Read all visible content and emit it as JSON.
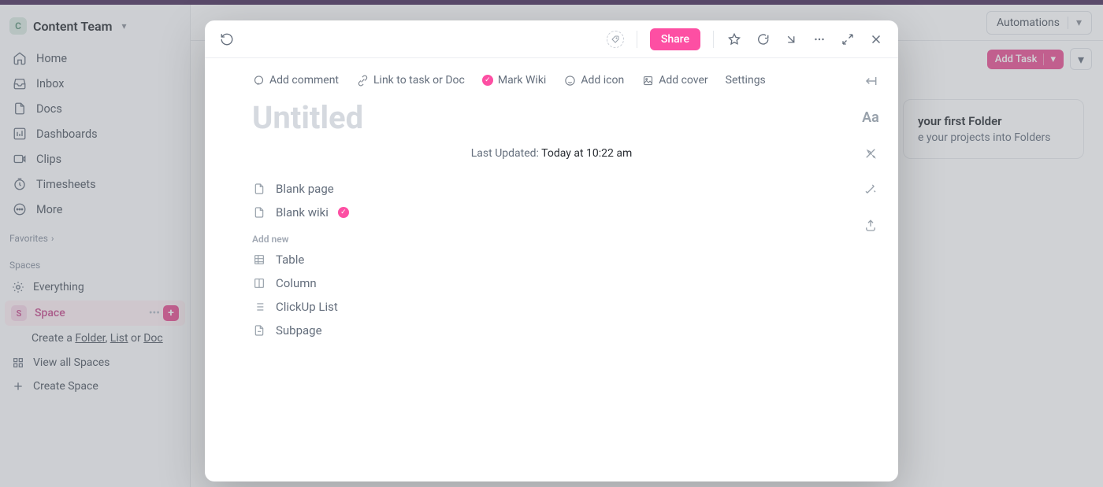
{
  "workspace": {
    "badge": "C",
    "name": "Content Team"
  },
  "sidebar": {
    "nav": [
      {
        "label": "Home",
        "icon": "home-icon"
      },
      {
        "label": "Inbox",
        "icon": "inbox-icon"
      },
      {
        "label": "Docs",
        "icon": "docs-icon"
      },
      {
        "label": "Dashboards",
        "icon": "dashboards-icon"
      },
      {
        "label": "Clips",
        "icon": "clips-icon"
      },
      {
        "label": "Timesheets",
        "icon": "timesheets-icon"
      },
      {
        "label": "More",
        "icon": "more-icon"
      }
    ],
    "favorites_label": "Favorites",
    "spaces_label": "Spaces",
    "everything_label": "Everything",
    "space": {
      "badge": "S",
      "name": "Space"
    },
    "create_prefix": "Create a ",
    "create_folder": "Folder",
    "create_list": "List",
    "create_or": " or ",
    "create_doc": "Doc",
    "view_all": "View all Spaces",
    "create_space": "Create Space"
  },
  "main": {
    "automations": "Automations",
    "add_task": "Add Task",
    "hint_title": "your first Folder",
    "hint_body": "e your projects into Folders"
  },
  "modal": {
    "share": "Share",
    "toolbar": {
      "add_comment": "Add comment",
      "link_task": "Link to task or Doc",
      "mark_wiki": "Mark Wiki",
      "add_icon": "Add icon",
      "add_cover": "Add cover",
      "settings": "Settings"
    },
    "title_placeholder": "Untitled",
    "last_updated_label": "Last Updated:",
    "last_updated_value": "Today at 10:22 am",
    "templates": {
      "blank_page": "Blank page",
      "blank_wiki": "Blank wiki"
    },
    "add_new_label": "Add new",
    "add_new": {
      "table": "Table",
      "column": "Column",
      "clickup_list": "ClickUp List",
      "subpage": "Subpage"
    }
  }
}
